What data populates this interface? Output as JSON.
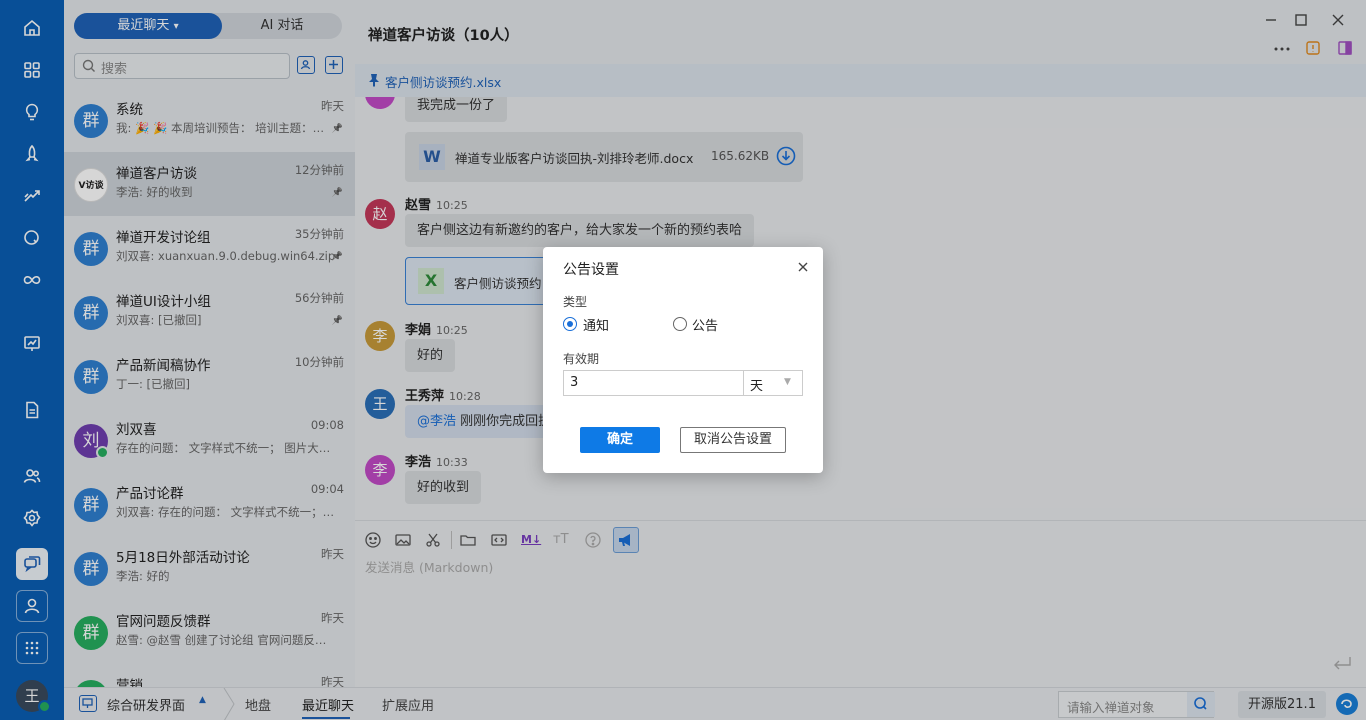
{
  "list_tabs": {
    "recent": "最近聊天",
    "ai": "AI 对话"
  },
  "search": {
    "placeholder": "搜索"
  },
  "conversations": [
    {
      "name": "系统",
      "time": "昨天",
      "last": "我: 🎉 🎉 本周培训预告：  培训主题：…",
      "avatar": "群",
      "color": "#2f80d1",
      "pinned": true
    },
    {
      "name": "禅道客户访谈",
      "time": "12分钟前",
      "last": "李浩: 好的收到",
      "avatar": "V访谈",
      "color": "#ffffff",
      "pinned": true
    },
    {
      "name": "禅道开发讨论组",
      "time": "35分钟前",
      "last": "刘双喜: xuanxuan.9.0.debug.win64.zip",
      "avatar": "群",
      "color": "#2f80d1",
      "pinned": true
    },
    {
      "name": "禅道UI设计小组",
      "time": "56分钟前",
      "last": "刘双喜: [已撤回]",
      "avatar": "群",
      "color": "#2f80d1",
      "pinned": true
    },
    {
      "name": "产品新闻稿协作",
      "time": "10分钟前",
      "last": "丁一: [已撤回]",
      "avatar": "群",
      "color": "#2f80d1",
      "pinned": false
    },
    {
      "name": "刘双喜",
      "time": "09:08",
      "last": "存在的问题：  文字样式不统一；  图片大…",
      "avatar": "刘",
      "color": "#6f3fb0",
      "pinned": false
    },
    {
      "name": "产品讨论群",
      "time": "09:04",
      "last": "刘双喜: 存在的问题：  文字样式不统一；…",
      "avatar": "群",
      "color": "#2f80d1",
      "pinned": false
    },
    {
      "name": "5月18日外部活动讨论",
      "time": "昨天",
      "last": "李浩: 好的",
      "avatar": "群",
      "color": "#2f80d1",
      "pinned": false
    },
    {
      "name": "官网问题反馈群",
      "time": "昨天",
      "last": "赵雪: @赵雪 创建了讨论组 官网问题反…",
      "avatar": "群",
      "color": "#27ae60",
      "pinned": false
    },
    {
      "name": "营销",
      "time": "昨天",
      "last": "",
      "avatar": "群",
      "color": "#27ae60",
      "pinned": false
    }
  ],
  "chat": {
    "title": "禅道客户访谈（10人）",
    "pinned_file": "客户侧访谈预约.xlsx",
    "msg1_text": "我完成一份了",
    "file1_name": "禅道专业版客户访谈回执-刘排玲老师.docx",
    "file1_size": "165.62KB",
    "file1_icon": "W",
    "zhao_avatar": "赵",
    "zhao_name": "赵雪",
    "zhao_time": "10:25",
    "zhao_text": "客户侧这边有新邀约的客户，给大家发一个新的预约表哈",
    "file2_name": "客户侧访谈预约",
    "file2_icon": "X",
    "lijuan_avatar": "李",
    "lijuan_name": "李娟",
    "lijuan_time": "10:25",
    "lijuan_text": "好的",
    "wang_avatar": "王",
    "wang_name": "王秀萍",
    "wang_time": "10:28",
    "wang_mention": "@李浩",
    "wang_text": " 刚刚你完成回执",
    "lihao_avatar": "李",
    "lihao_name": "李浩",
    "lihao_time": "10:33",
    "lihao_text": "好的收到",
    "input_placeholder": "发送消息 (Markdown)"
  },
  "dialog": {
    "title": "公告设置",
    "type_label": "类型",
    "opt_notice": "通知",
    "opt_announce": "公告",
    "selected": "notice",
    "validity_label": "有效期",
    "validity_value": "3",
    "unit": "天",
    "confirm": "确定",
    "cancel": "取消公告设置"
  },
  "statusbar": {
    "workspace": "综合研发界面",
    "nav": [
      "地盘",
      "最近聊天",
      "扩展应用"
    ],
    "active_nav": "最近聊天",
    "search_placeholder": "请输入禅道对象",
    "version": "开源版21.1"
  },
  "user_avatar": "王",
  "colors": {
    "accent": "#1a6fd8",
    "rail": "#0a5fb4",
    "selected_row": "#cdd3d9"
  }
}
